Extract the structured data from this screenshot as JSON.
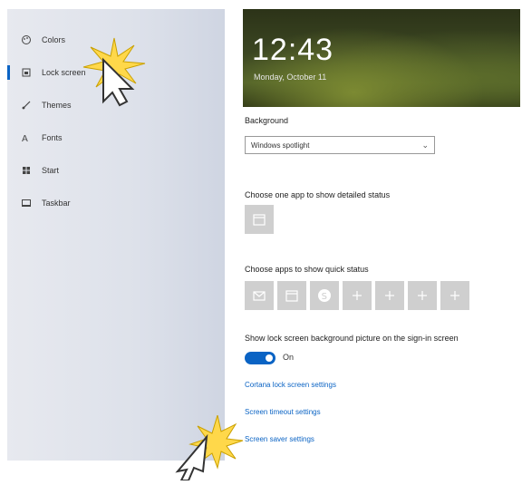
{
  "sidebar": {
    "items": [
      {
        "label": "Colors",
        "icon": "palette-icon"
      },
      {
        "label": "Lock screen",
        "icon": "lock-screen-icon",
        "selected": true
      },
      {
        "label": "Themes",
        "icon": "brush-icon"
      },
      {
        "label": "Fonts",
        "icon": "font-icon"
      },
      {
        "label": "Start",
        "icon": "start-icon"
      },
      {
        "label": "Taskbar",
        "icon": "taskbar-icon"
      }
    ]
  },
  "preview": {
    "time": "12:43",
    "date": "Monday, October 11"
  },
  "background": {
    "label": "Background",
    "value": "Windows spotlight"
  },
  "detailed_status": {
    "label": "Choose one app to show detailed status"
  },
  "quick_status": {
    "label": "Choose apps to show quick status"
  },
  "sign_in_background": {
    "label": "Show lock screen background picture on the sign-in screen",
    "state": "On"
  },
  "links": {
    "cortana": "Cortana lock screen settings",
    "timeout": "Screen timeout settings",
    "screensaver": "Screen saver settings"
  },
  "colors": {
    "accent": "#0a63c4",
    "sidebar": "#dde1ea",
    "tile": "#cfcfcf"
  }
}
